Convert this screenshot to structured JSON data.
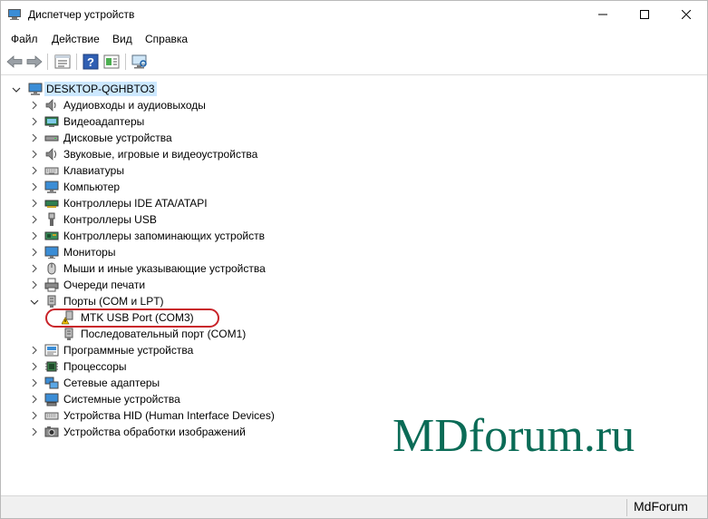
{
  "window": {
    "title": "Диспетчер устройств",
    "controls": [
      "minimize",
      "maximize",
      "close"
    ]
  },
  "menu": [
    {
      "label": "Файл"
    },
    {
      "label": "Действие"
    },
    {
      "label": "Вид"
    },
    {
      "label": "Справка"
    }
  ],
  "toolbar": {
    "buttons": [
      "back-icon",
      "forward-icon",
      "properties-icon",
      "help-icon",
      "update-driver-icon",
      "scan-hardware-icon"
    ]
  },
  "tree": {
    "root": {
      "label": "DESKTOP-QGHBTO3",
      "expanded": true,
      "selected": true
    },
    "items": [
      {
        "label": "Аудиовходы и аудиовыходы",
        "icon": "speaker-icon",
        "expanded": false
      },
      {
        "label": "Видеоадаптеры",
        "icon": "display-adapter-icon",
        "expanded": false
      },
      {
        "label": "Дисковые устройства",
        "icon": "disk-drive-icon",
        "expanded": false
      },
      {
        "label": "Звуковые, игровые и видеоустройства",
        "icon": "sound-card-icon",
        "expanded": false
      },
      {
        "label": "Клавиатуры",
        "icon": "keyboard-icon",
        "expanded": false
      },
      {
        "label": "Компьютер",
        "icon": "computer-icon",
        "expanded": false
      },
      {
        "label": "Контроллеры IDE ATA/ATAPI",
        "icon": "ide-controller-icon",
        "expanded": false
      },
      {
        "label": "Контроллеры USB",
        "icon": "usb-icon",
        "expanded": false
      },
      {
        "label": "Контроллеры запоминающих устройств",
        "icon": "storage-controller-icon",
        "expanded": false
      },
      {
        "label": "Мониторы",
        "icon": "monitor-icon",
        "expanded": false
      },
      {
        "label": "Мыши и иные указывающие устройства",
        "icon": "mouse-icon",
        "expanded": false
      },
      {
        "label": "Очереди печати",
        "icon": "printer-icon",
        "expanded": false
      },
      {
        "label": "Порты (COM и LPT)",
        "icon": "port-icon",
        "expanded": true,
        "children": [
          {
            "label": "MTK USB Port (COM3)",
            "icon": "warning-port-icon"
          },
          {
            "label": "Последовательный порт (COM1)",
            "icon": "port-icon"
          }
        ]
      },
      {
        "label": "Программные устройства",
        "icon": "software-device-icon",
        "expanded": false
      },
      {
        "label": "Процессоры",
        "icon": "cpu-icon",
        "expanded": false
      },
      {
        "label": "Сетевые адаптеры",
        "icon": "network-adapter-icon",
        "expanded": false
      },
      {
        "label": "Системные устройства",
        "icon": "system-device-icon",
        "expanded": false
      },
      {
        "label": "Устройства HID (Human Interface Devices)",
        "icon": "hid-icon",
        "expanded": false
      },
      {
        "label": "Устройства обработки изображений",
        "icon": "camera-icon",
        "expanded": false
      }
    ]
  },
  "watermark": "MDforum.ru",
  "status": {
    "text": "MdForum"
  },
  "colors": {
    "selection": "#cce8ff",
    "highlight": "#c9242a",
    "watermark": "#0a6b56"
  }
}
